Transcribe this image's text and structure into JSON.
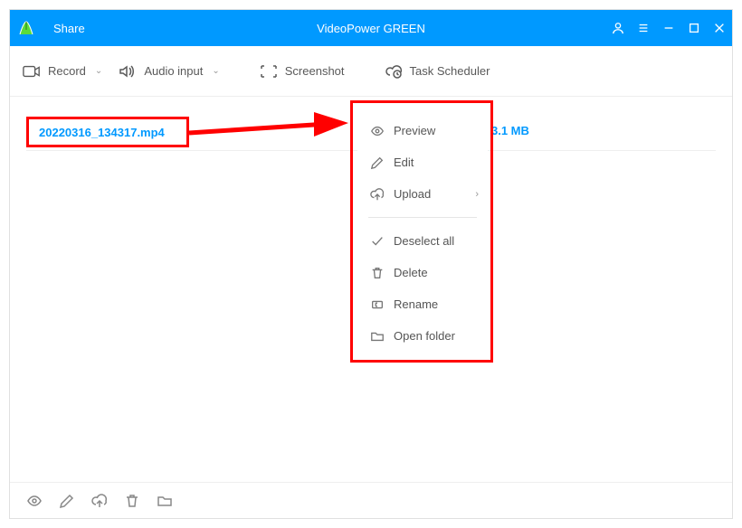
{
  "titlebar": {
    "share_label": "Share",
    "app_title": "VideoPower GREEN"
  },
  "toolbar": {
    "record_label": "Record",
    "audio_label": "Audio input",
    "screenshot_label": "Screenshot",
    "scheduler_label": "Task Scheduler"
  },
  "file": {
    "name": "20220316_134317.mp4",
    "size": "3.1 MB"
  },
  "context_menu": {
    "preview": "Preview",
    "edit": "Edit",
    "upload": "Upload",
    "deselect": "Deselect all",
    "delete": "Delete",
    "rename": "Rename",
    "open_folder": "Open folder"
  },
  "colors": {
    "accent": "#0099ff",
    "highlight": "#ff0000"
  }
}
